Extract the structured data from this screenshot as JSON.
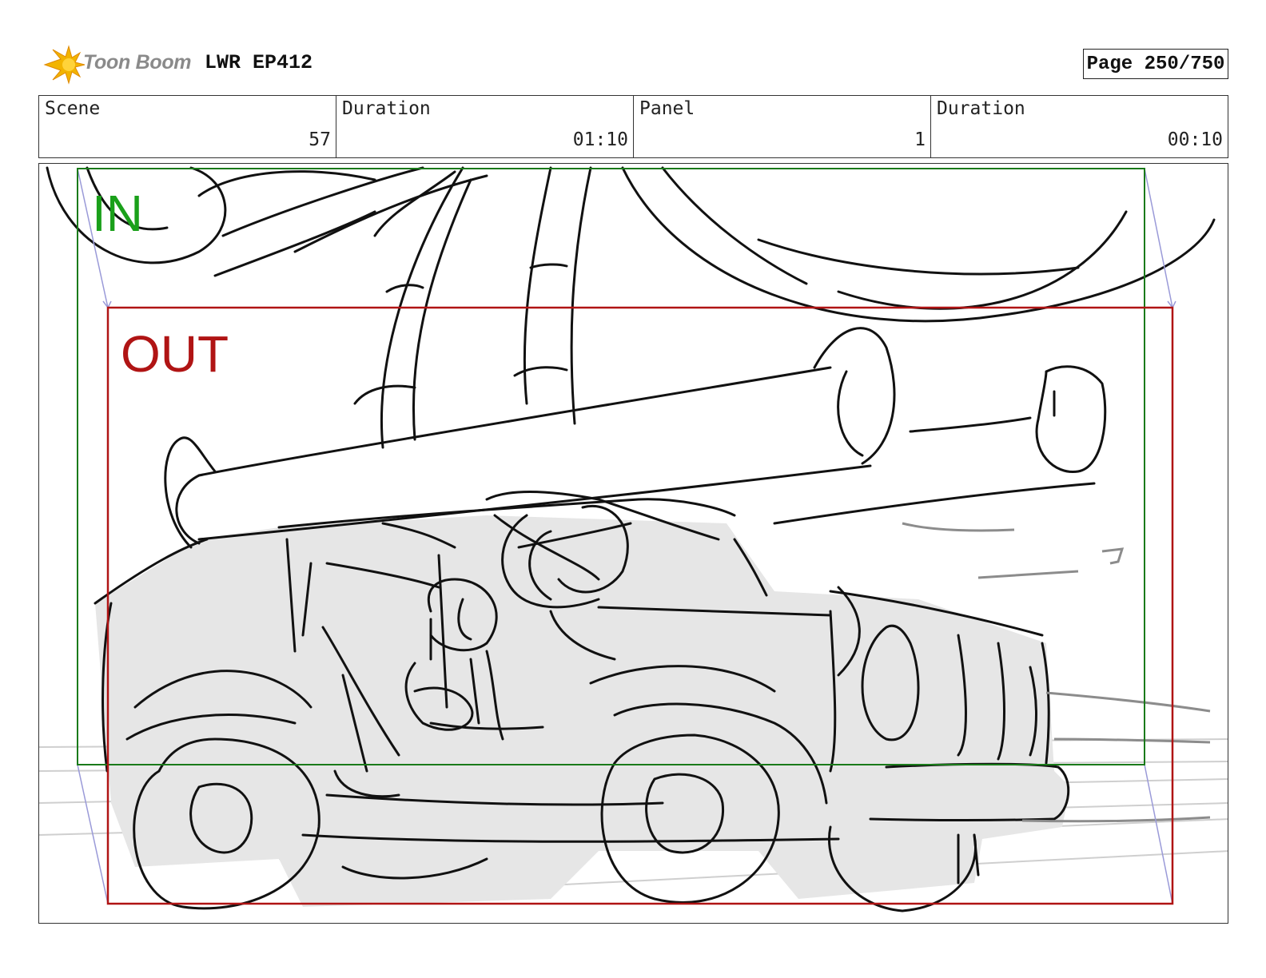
{
  "header": {
    "logo_text": "Toon Boom",
    "project": "LWR EP412",
    "page_label": "Page 250/750"
  },
  "info": {
    "scene_label": "Scene",
    "scene_value": "57",
    "scene_duration_label": "Duration",
    "scene_duration_value": "01:10",
    "panel_label": "Panel",
    "panel_value": "1",
    "panel_duration_label": "Duration",
    "panel_duration_value": "00:10"
  },
  "frame": {
    "in_label": "IN",
    "out_label": "OUT",
    "in_color": "#1a7a1a",
    "out_color": "#b01414"
  }
}
